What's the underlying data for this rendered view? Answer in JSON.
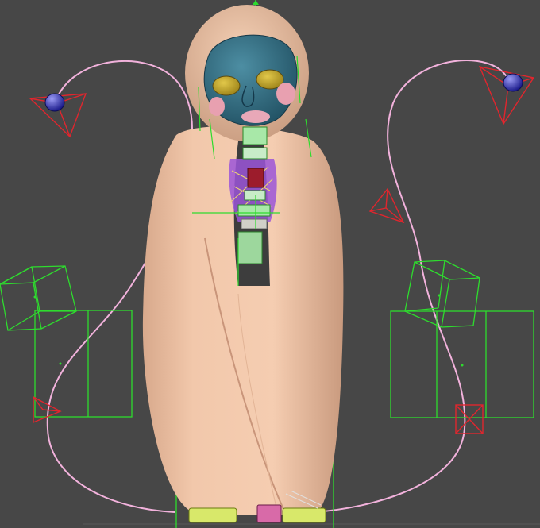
{
  "viewport": {
    "background": "#474747",
    "grid_color": "#5a5a5a",
    "helper_green": "#2edc2e",
    "camera_red": "#e0262e",
    "motion_path_pink": "#f2b2dc",
    "light_blue": "#3a3ad0",
    "skin_color": "#f0c4a6",
    "mask_color": "#2f6f86",
    "eye_color": "#c6a826"
  },
  "icons": [
    "world-axis-up-icon",
    "light-icon",
    "camera-icon"
  ]
}
